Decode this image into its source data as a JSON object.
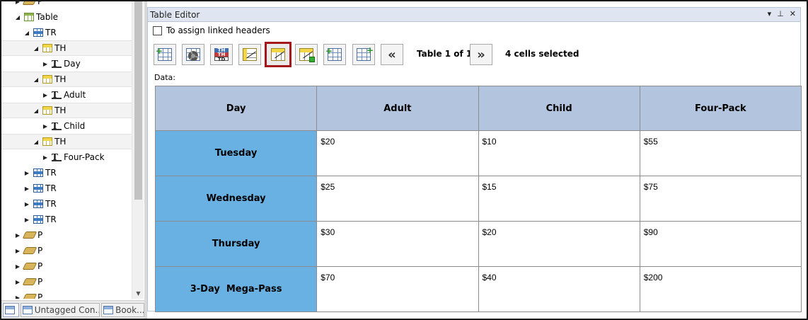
{
  "tree": {
    "items": [
      {
        "label": "P",
        "type": "p",
        "level": 2,
        "expander": "collapsed"
      },
      {
        "label": "Table",
        "type": "table",
        "level": 2,
        "expander": "expanded"
      },
      {
        "label": "TR",
        "type": "tr",
        "level": 3,
        "expander": "expanded"
      },
      {
        "label": "TH",
        "type": "th",
        "level": 4,
        "expander": "expanded"
      },
      {
        "label": "Day",
        "type": "text",
        "level": 5,
        "expander": "collapsed"
      },
      {
        "label": "TH",
        "type": "th",
        "level": 4,
        "expander": "expanded"
      },
      {
        "label": "Adult",
        "type": "text",
        "level": 5,
        "expander": "collapsed"
      },
      {
        "label": "TH",
        "type": "th",
        "level": 4,
        "expander": "expanded"
      },
      {
        "label": "Child",
        "type": "text",
        "level": 5,
        "expander": "collapsed"
      },
      {
        "label": "TH",
        "type": "th",
        "level": 4,
        "expander": "expanded"
      },
      {
        "label": "Four-Pack",
        "type": "text",
        "level": 5,
        "expander": "collapsed"
      },
      {
        "label": "TR",
        "type": "tr",
        "level": 3,
        "expander": "collapsed"
      },
      {
        "label": "TR",
        "type": "tr",
        "level": 3,
        "expander": "collapsed"
      },
      {
        "label": "TR",
        "type": "tr",
        "level": 3,
        "expander": "collapsed"
      },
      {
        "label": "TR",
        "type": "tr",
        "level": 3,
        "expander": "collapsed"
      },
      {
        "label": "P",
        "type": "p",
        "level": 2,
        "expander": "collapsed"
      },
      {
        "label": "P",
        "type": "p",
        "level": 2,
        "expander": "collapsed"
      },
      {
        "label": "P",
        "type": "p",
        "level": 2,
        "expander": "collapsed"
      },
      {
        "label": "P",
        "type": "p",
        "level": 2,
        "expander": "collapsed"
      },
      {
        "label": "P",
        "type": "p",
        "level": 2,
        "expander": "collapsed"
      }
    ]
  },
  "tabs": [
    {
      "label": "",
      "active": true
    },
    {
      "label": "Untagged Con...",
      "active": false
    },
    {
      "label": "Book...",
      "active": false
    }
  ],
  "editor": {
    "title": "Table Editor",
    "title_buttons": {
      "dropdown": "▾",
      "pin": "⊥",
      "close": "✕"
    },
    "checkbox_label": "To assign linked headers",
    "checkbox_checked": false,
    "toolbar_icons": [
      "insert-row-icon",
      "table-properties-icon",
      "th-td-toggle-icon",
      "column-header-icon",
      "selected-cell-header-icon",
      "row-header-icon",
      "insert-column-icon",
      "delete-column-icon"
    ],
    "prev_label": "«",
    "next_label": "»",
    "table_label": "Table 1 of 1",
    "cells_label": "4 cells selected",
    "data_label": "Data:",
    "colors": {
      "header": "#b2c4de",
      "row_header": "#69b1e3",
      "selected_outline": "#a4161a"
    }
  },
  "grid": {
    "headers": [
      "Day",
      "Adult",
      "Child",
      "Four-Pack"
    ],
    "rows": [
      {
        "head": "Tuesday",
        "cells": [
          "$20",
          "$10",
          "$55"
        ]
      },
      {
        "head": "Wednesday",
        "cells": [
          "$25",
          "$15",
          "$75"
        ]
      },
      {
        "head": "Thursday",
        "cells": [
          "$30",
          "$20",
          "$90"
        ]
      },
      {
        "head": "3-Day  Mega-Pass",
        "cells": [
          "$70",
          "$40",
          "$200"
        ]
      }
    ]
  }
}
